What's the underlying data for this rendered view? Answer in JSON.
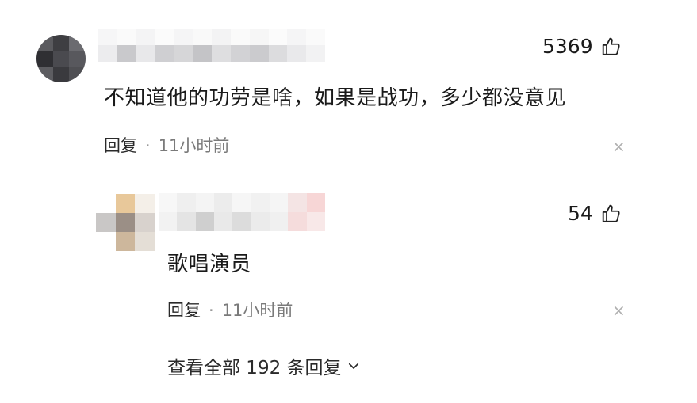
{
  "comment": {
    "text": "不知道他的功劳是啥，如果是战功，多少都没意见",
    "likes": "5369",
    "reply_label": "回复",
    "dot": "·",
    "time": "11小时前",
    "close_glyph": "×"
  },
  "reply": {
    "text": "歌唱演员",
    "likes": "54",
    "reply_label": "回复",
    "dot": "·",
    "time": "11小时前",
    "close_glyph": "×"
  },
  "view_all": {
    "label": "查看全部 192 条回复"
  },
  "icons": {
    "like": "thumbs-up-icon",
    "expand": "chevron-down-icon",
    "close": "close-icon"
  }
}
